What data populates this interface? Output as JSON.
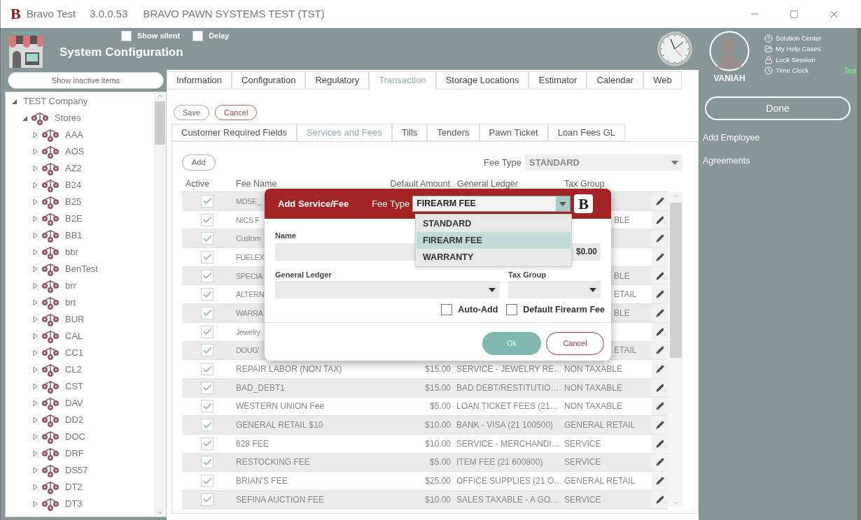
{
  "window": {
    "logo": "B",
    "app_name": "Bravo Test",
    "version": "3.0.0.53",
    "title": "BRAVO PAWN SYSTEMS TEST (TST)"
  },
  "header": {
    "title": "System Configuration",
    "options": [
      {
        "label": "Show silent",
        "checked": false
      },
      {
        "label": "Delay",
        "checked": false
      }
    ]
  },
  "user": {
    "name": "VANIAH",
    "status": "Test",
    "links": [
      {
        "label": "Solution Center",
        "kind": "help"
      },
      {
        "label": "My Help Cases",
        "kind": "folder"
      },
      {
        "label": "Lock Session",
        "kind": "lock"
      },
      {
        "label": "Time Clock",
        "kind": "clock"
      }
    ]
  },
  "side_actions": {
    "done": "Done",
    "items": [
      "Add Employee",
      "Agreements"
    ]
  },
  "show_inactive_button": "Show inactive items",
  "tree": [
    {
      "label": "TEST Company",
      "expanded": true,
      "children": [
        {
          "label": "Stores",
          "expanded": true,
          "children": [
            {
              "label": "AAA",
              "expanded": false
            },
            {
              "label": "AOS",
              "expanded": false
            },
            {
              "label": "AZ2",
              "expanded": false
            },
            {
              "label": "B24",
              "expanded": false
            },
            {
              "label": "B25",
              "expanded": false
            },
            {
              "label": "B2E",
              "expanded": false
            },
            {
              "label": "BB1",
              "expanded": false
            },
            {
              "label": "bbr",
              "expanded": false
            },
            {
              "label": "BenTest",
              "expanded": false
            },
            {
              "label": "brr",
              "expanded": false
            },
            {
              "label": "brt",
              "expanded": false
            },
            {
              "label": "BUR",
              "expanded": false
            },
            {
              "label": "CAL",
              "expanded": false
            },
            {
              "label": "CC1",
              "expanded": false
            },
            {
              "label": "CL2",
              "expanded": false
            },
            {
              "label": "CST",
              "expanded": false
            },
            {
              "label": "DAV",
              "expanded": false
            },
            {
              "label": "DD2",
              "expanded": false
            },
            {
              "label": "DOC",
              "expanded": false
            },
            {
              "label": "DRF",
              "expanded": false
            },
            {
              "label": "DS57",
              "expanded": false
            },
            {
              "label": "DT2",
              "expanded": false
            },
            {
              "label": "DT3",
              "expanded": false
            }
          ]
        }
      ]
    }
  ],
  "tabs": [
    {
      "label": "Information",
      "selected": false
    },
    {
      "label": "Configuration",
      "selected": false
    },
    {
      "label": "Regulatory",
      "selected": false
    },
    {
      "label": "Transaction",
      "selected": true
    },
    {
      "label": "Storage Locations",
      "selected": false
    },
    {
      "label": "Estimator",
      "selected": false
    },
    {
      "label": "Calendar",
      "selected": false
    },
    {
      "label": "Web",
      "selected": false
    }
  ],
  "actions": {
    "save": "Save",
    "cancel": "Cancel"
  },
  "sub_tabs": [
    {
      "label": "Customer Required Fields",
      "selected": false
    },
    {
      "label": "Services and Fees",
      "selected": true
    },
    {
      "label": "Tills",
      "selected": false
    },
    {
      "label": "Tenders",
      "selected": false
    },
    {
      "label": "Pawn Ticket",
      "selected": false
    },
    {
      "label": "Loan Fees GL",
      "selected": false
    }
  ],
  "add_button": "Add",
  "fee_filter": {
    "label": "Fee Type",
    "value": "STANDARD"
  },
  "table": {
    "columns": [
      "Active",
      "Fee Name",
      "Default Amount",
      "General Ledger",
      "Tax Group"
    ],
    "rows": [
      {
        "kind": "under_dialog",
        "active": true,
        "fee_name": "MDSE_"
      },
      {
        "kind": "under_dialog",
        "active": true,
        "fee_name": "NICS F",
        "tax_group": "BLE"
      },
      {
        "kind": "under_dialog",
        "active": true,
        "fee_name": "Custom"
      },
      {
        "kind": "under_dialog",
        "active": true,
        "fee_name": "FUELEX"
      },
      {
        "kind": "under_dialog",
        "active": true,
        "fee_name": "SPECIA",
        "tax_group": "BLE"
      },
      {
        "kind": "under_dialog",
        "active": true,
        "fee_name": "ALTERN",
        "tax_group": "ETAIL"
      },
      {
        "kind": "under_dialog",
        "active": true,
        "fee_name": "WARRA",
        "tax_group": "BLE"
      },
      {
        "kind": "under_dialog",
        "active": true,
        "fee_name": "Jewelry"
      },
      {
        "kind": "under_dialog",
        "active": true,
        "fee_name": "DOUG'",
        "tax_group": "ETAIL"
      },
      {
        "kind": "full",
        "active": true,
        "fee_name": "REPAIR LABOR (NON TAX)",
        "default_amount": "$15.00",
        "general_ledger": "SERVICE - JEWELRY RE…",
        "tax_group": "NON TAXABLE"
      },
      {
        "kind": "full",
        "active": true,
        "fee_name": "BAD_DEBT1",
        "default_amount": "$15.00",
        "general_ledger": "BAD DEBT/RESTITUTIO…",
        "tax_group": "NON TAXABLE"
      },
      {
        "kind": "full",
        "active": true,
        "fee_name": "WESTERN UNION Fee",
        "default_amount": "$5.00",
        "general_ledger": "LOAN TICKET FEES (21…",
        "tax_group": "NON TAXABLE"
      },
      {
        "kind": "full",
        "active": true,
        "fee_name": "GENERAL RETAIL $10",
        "default_amount": "$10.00",
        "general_ledger": "BANK - VISA (21 100500)",
        "tax_group": "GENERAL RETAIL"
      },
      {
        "kind": "full",
        "active": true,
        "fee_name": "628 FEE",
        "default_amount": "$10.00",
        "general_ledger": "SERVICE - MERCHANDI…",
        "tax_group": "SERVICE"
      },
      {
        "kind": "full",
        "active": true,
        "fee_name": "RESTOCKING FEE",
        "default_amount": "$5.00",
        "general_ledger": "ITEM FEE (21 600800)",
        "tax_group": "SERVICE"
      },
      {
        "kind": "full",
        "active": true,
        "fee_name": "BRIAN'S FEE",
        "default_amount": "$25.00",
        "general_ledger": "OFFICE SUPPLIES (21 O…",
        "tax_group": "GENERAL RETAIL"
      },
      {
        "kind": "full",
        "active": true,
        "fee_name": "SEFINA AUCTION FEE",
        "default_amount": "$10.00",
        "general_ledger": "SALES TAXABLE - A GO…",
        "tax_group": "SERVICE"
      }
    ]
  },
  "dialog": {
    "title": "Add Service/Fee",
    "logo": "B",
    "fee_type_label": "Fee Type",
    "fee_type_value": "FIREARM FEE",
    "fee_type_options": [
      {
        "label": "STANDARD",
        "selected": false
      },
      {
        "label": "FIREARM FEE",
        "selected": true
      },
      {
        "label": "WARRANTY",
        "selected": false
      }
    ],
    "name_label": "Name",
    "amount_value": "$0.00",
    "general_ledger_label": "General Ledger",
    "tax_group_label": "Tax Group",
    "checkboxes": [
      {
        "label": "Auto-Add",
        "checked": false
      },
      {
        "label": "Default Firearm Fee",
        "checked": false
      }
    ],
    "ok": "Ok",
    "cancel": "Cancel"
  }
}
